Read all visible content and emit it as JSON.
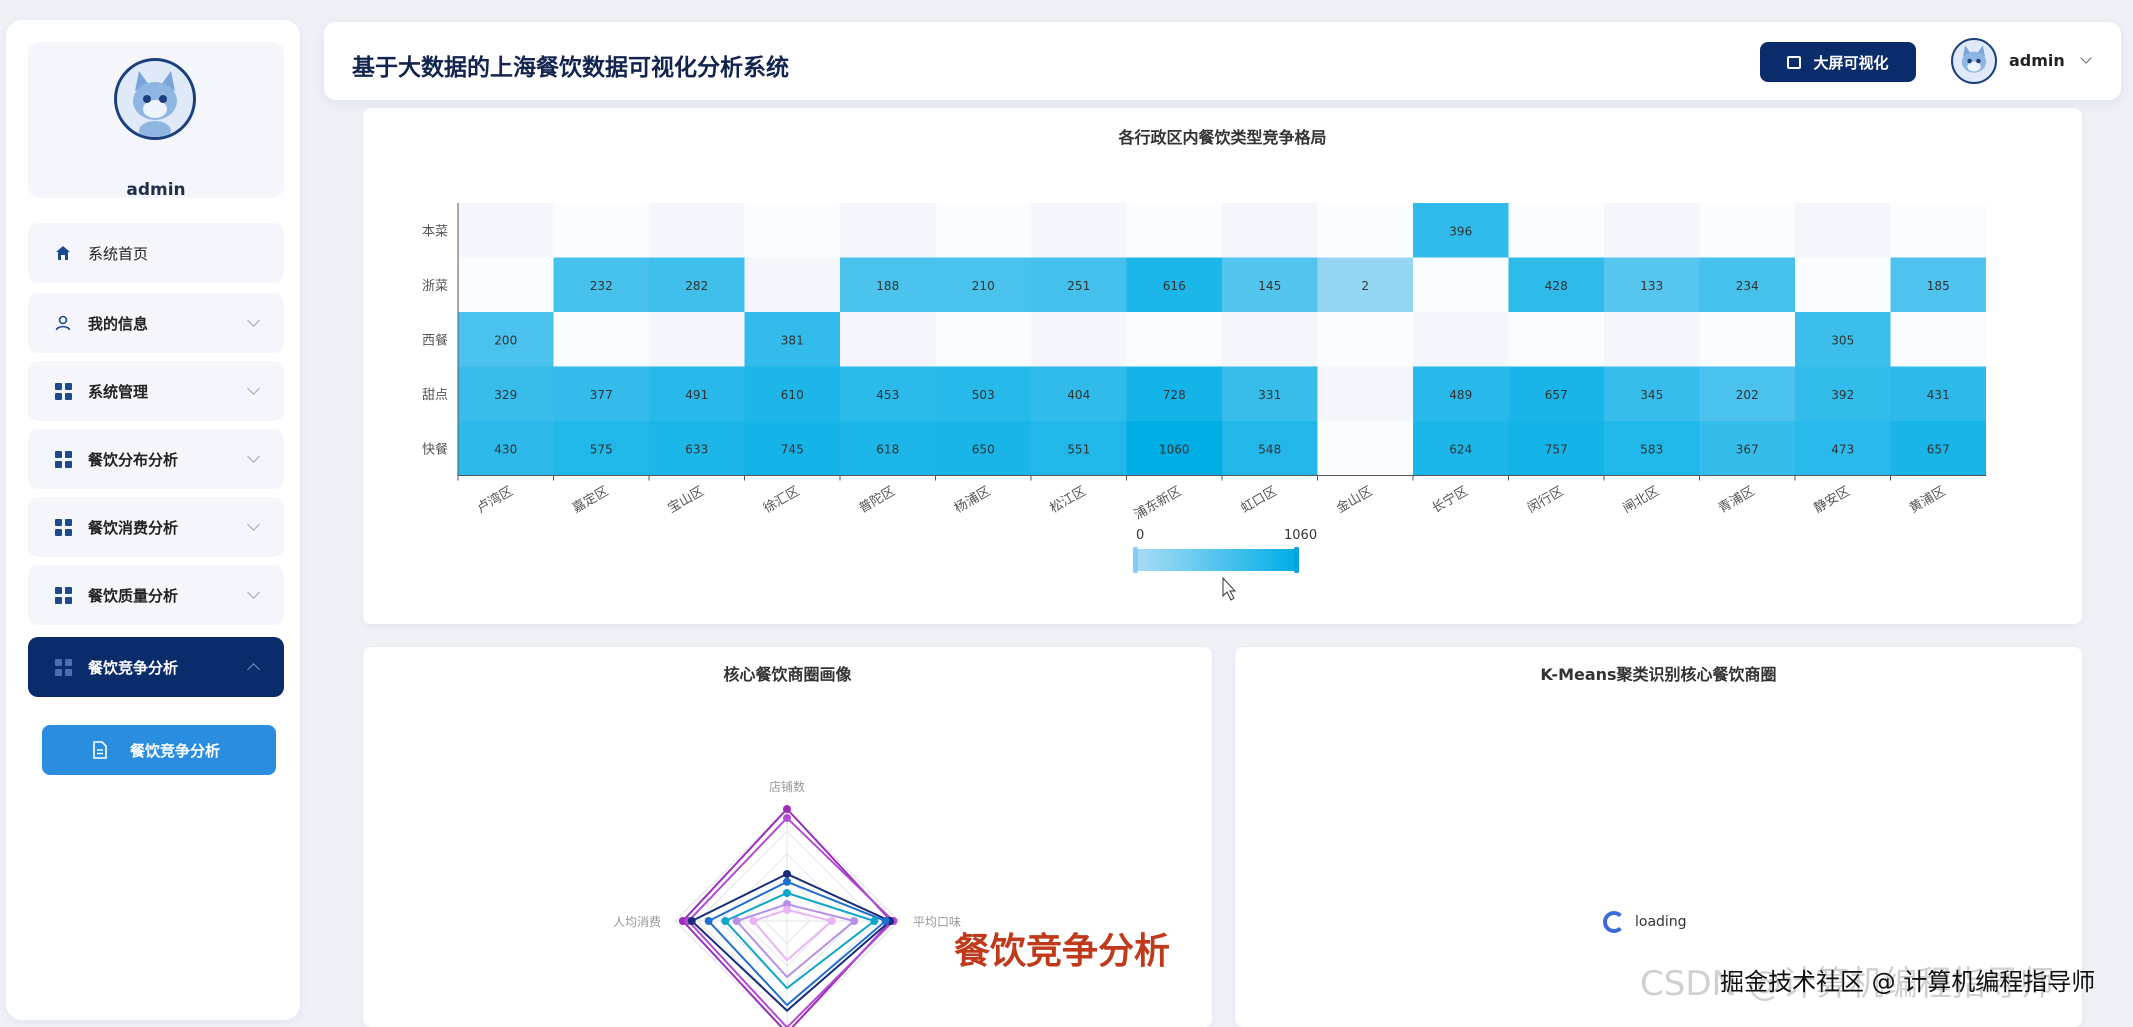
{
  "sidebar": {
    "username": "admin",
    "items": [
      {
        "label": "系统首页",
        "icon": "home-icon"
      },
      {
        "label": "我的信息",
        "icon": "user-icon"
      },
      {
        "label": "系统管理",
        "icon": "grid-icon"
      },
      {
        "label": "餐饮分布分析",
        "icon": "grid-icon"
      },
      {
        "label": "餐饮消费分析",
        "icon": "grid-icon"
      },
      {
        "label": "餐饮质量分析",
        "icon": "grid-icon"
      },
      {
        "label": "餐饮竞争分析",
        "icon": "grid-icon"
      }
    ],
    "submenu": {
      "label": "餐饮竞争分析",
      "icon": "document-icon"
    }
  },
  "header": {
    "title": "基于大数据的上海餐饮数据可视化分析系统",
    "big_screen_label": "大屏可视化",
    "username": "admin"
  },
  "heatmap": {
    "title": "各行政区内餐饮类型竞争格局",
    "visual_map": {
      "min": "0",
      "max": "1060"
    }
  },
  "radar": {
    "title": "核心餐饮商圈画像",
    "indicators": [
      "店铺数",
      "平均口味",
      "人均消费"
    ]
  },
  "kmeans": {
    "title": "K-Means聚类识别核心餐饮商圈",
    "loading_text": "loading"
  },
  "overlay": {
    "caption": "餐饮竞争分析",
    "watermark_bg": "CSDN @计算机编程指导师",
    "watermark_fg": "掘金技术社区 @ 计算机编程指导师"
  },
  "colors": {
    "primary": "#0b2c6b",
    "accent": "#2a8de0",
    "heat_max": "#00aee6"
  },
  "chart_data": [
    {
      "type": "heatmap",
      "title": "各行政区内餐饮类型竞争格局",
      "x": [
        "卢湾区",
        "嘉定区",
        "宝山区",
        "徐汇区",
        "普陀区",
        "杨浦区",
        "松江区",
        "浦东新区",
        "虹口区",
        "金山区",
        "长宁区",
        "闵行区",
        "闸北区",
        "青浦区",
        "静安区",
        "黄浦区"
      ],
      "y": [
        "快餐",
        "甜点",
        "西餐",
        "浙菜",
        "本菜"
      ],
      "values": [
        [
          430,
          575,
          633,
          745,
          618,
          650,
          551,
          1060,
          548,
          null,
          624,
          757,
          583,
          367,
          473,
          657
        ],
        [
          329,
          377,
          491,
          610,
          453,
          503,
          404,
          728,
          331,
          null,
          489,
          657,
          345,
          202,
          392,
          431
        ],
        [
          200,
          null,
          null,
          381,
          null,
          null,
          null,
          null,
          null,
          null,
          null,
          null,
          null,
          null,
          305,
          null
        ],
        [
          null,
          232,
          282,
          null,
          188,
          210,
          251,
          616,
          145,
          2,
          null,
          428,
          133,
          234,
          null,
          185
        ],
        [
          null,
          null,
          null,
          null,
          null,
          null,
          null,
          null,
          null,
          null,
          396,
          null,
          null,
          null,
          null,
          null
        ]
      ],
      "range": [
        0,
        1060
      ]
    },
    {
      "type": "radar",
      "title": "核心餐饮商圈画像",
      "indicators": [
        "店铺数",
        "平均口味",
        "人均消费"
      ]
    }
  ]
}
